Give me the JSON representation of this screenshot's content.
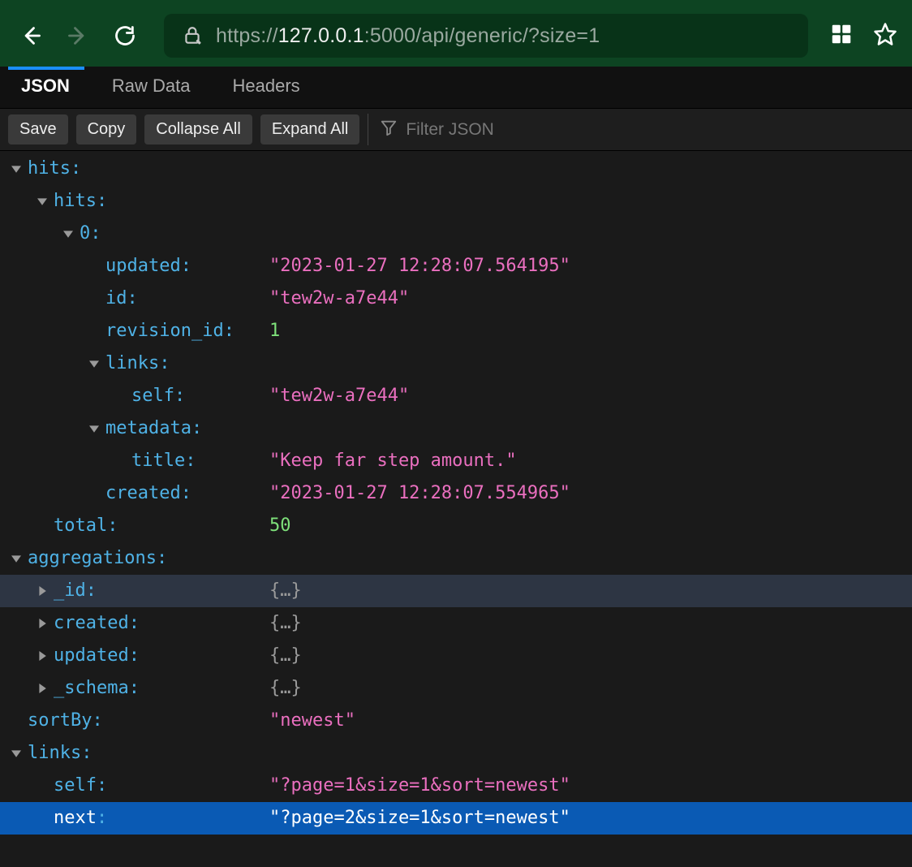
{
  "browser": {
    "url_prefix": "https://",
    "url_host": "127.0.0.1",
    "url_port_path": ":5000/api/generic/?size=1"
  },
  "tabs": {
    "json": "JSON",
    "raw": "Raw Data",
    "headers": "Headers"
  },
  "toolbar": {
    "save": "Save",
    "copy": "Copy",
    "collapse": "Collapse All",
    "expand": "Expand All",
    "filter_placeholder": "Filter JSON"
  },
  "json": {
    "hits_key": "hits",
    "hits_inner_key": "hits",
    "idx0": "0",
    "updated_key": "updated",
    "updated_val": "\"2023-01-27 12:28:07.564195\"",
    "id_key": "id",
    "id_val": "\"tew2w-a7e44\"",
    "revision_key": "revision_id",
    "revision_val": "1",
    "links_key": "links",
    "self_key": "self",
    "self_val": "\"tew2w-a7e44\"",
    "metadata_key": "metadata",
    "title_key": "title",
    "title_val": "\"Keep far step amount.\"",
    "created_key": "created",
    "created_val": "\"2023-01-27 12:28:07.554965\"",
    "total_key": "total",
    "total_val": "50",
    "aggregations_key": "aggregations",
    "agg_id_key": "_id",
    "agg_created_key": "created",
    "agg_updated_key": "updated",
    "agg_schema_key": "_schema",
    "collapsed": "{…}",
    "sortby_key": "sortBy",
    "sortby_val": "\"newest\"",
    "toplinks_key": "links",
    "toplinks_self_key": "self",
    "toplinks_self_val": "\"?page=1&size=1&sort=newest\"",
    "toplinks_next_key": "next",
    "toplinks_next_val": "\"?page=2&size=1&sort=newest\""
  }
}
